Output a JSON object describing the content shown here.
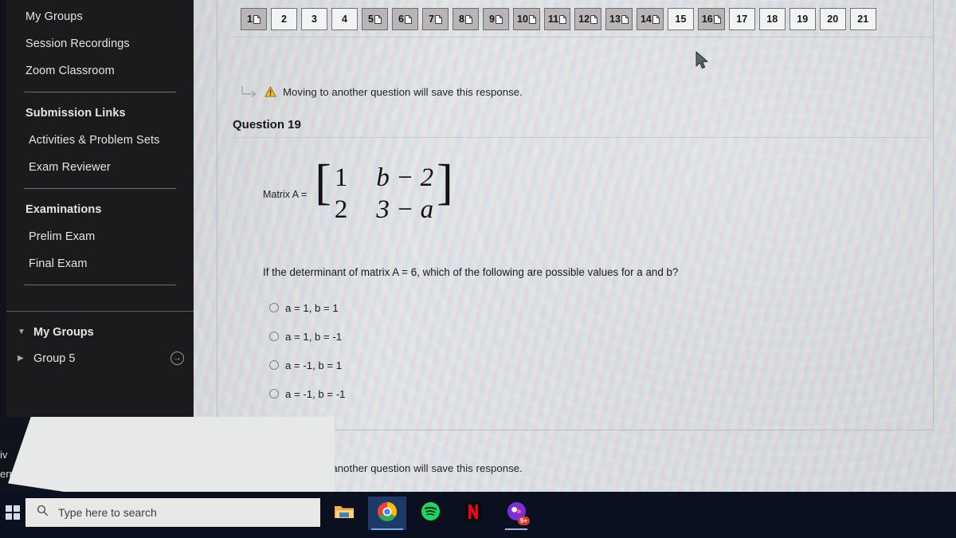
{
  "sidebar": {
    "top_items": [
      {
        "label": "My Groups",
        "bold": false
      },
      {
        "label": "Session Recordings",
        "bold": false
      },
      {
        "label": "Zoom Classroom",
        "bold": false
      }
    ],
    "section_submission": {
      "heading": "Submission Links",
      "items": [
        {
          "label": "Activities & Problem Sets"
        },
        {
          "label": "Exam Reviewer"
        }
      ]
    },
    "section_exams": {
      "heading": "Examinations",
      "items": [
        {
          "label": "Prelim Exam"
        },
        {
          "label": "Final Exam"
        }
      ]
    },
    "my_groups": {
      "heading": "My Groups",
      "expand_glyph": "▼",
      "items": [
        {
          "label": "Group 5",
          "collapse_glyph": "▶",
          "action_glyph": "→"
        }
      ]
    }
  },
  "occluded_window": {
    "fragment_top": "iv",
    "fragment_bottom": "err"
  },
  "question_nav": {
    "buttons": [
      {
        "number": "1",
        "has_doc_icon": true,
        "visited": true
      },
      {
        "number": "2",
        "has_doc_icon": false,
        "visited": false
      },
      {
        "number": "3",
        "has_doc_icon": false,
        "visited": false
      },
      {
        "number": "4",
        "has_doc_icon": false,
        "visited": false
      },
      {
        "number": "5",
        "has_doc_icon": true,
        "visited": true
      },
      {
        "number": "6",
        "has_doc_icon": true,
        "visited": true
      },
      {
        "number": "7",
        "has_doc_icon": true,
        "visited": true
      },
      {
        "number": "8",
        "has_doc_icon": true,
        "visited": true
      },
      {
        "number": "9",
        "has_doc_icon": true,
        "visited": true
      },
      {
        "number": "10",
        "has_doc_icon": true,
        "visited": true
      },
      {
        "number": "11",
        "has_doc_icon": true,
        "visited": true
      },
      {
        "number": "12",
        "has_doc_icon": true,
        "visited": true
      },
      {
        "number": "13",
        "has_doc_icon": true,
        "visited": true
      },
      {
        "number": "14",
        "has_doc_icon": true,
        "visited": true
      },
      {
        "number": "15",
        "has_doc_icon": false,
        "visited": false
      },
      {
        "number": "16",
        "has_doc_icon": true,
        "visited": true
      },
      {
        "number": "17",
        "has_doc_icon": false,
        "visited": false
      },
      {
        "number": "18",
        "has_doc_icon": false,
        "visited": false
      },
      {
        "number": "19",
        "has_doc_icon": false,
        "visited": false
      },
      {
        "number": "20",
        "has_doc_icon": false,
        "visited": false
      },
      {
        "number": "21",
        "has_doc_icon": false,
        "visited": false
      }
    ]
  },
  "notice_top": {
    "text": "Moving to another question will save this response."
  },
  "notice_bottom": {
    "text": "Moving to another question will save this response."
  },
  "question": {
    "heading": "Question 19",
    "matrix_label": "Matrix A =",
    "matrix": {
      "left_bracket": "[",
      "right_bracket": "]",
      "rows": [
        [
          {
            "text": "1",
            "italic": false
          },
          {
            "text": "b − 2",
            "italic": true
          }
        ],
        [
          {
            "text": "2",
            "italic": false
          },
          {
            "text": "3 − a",
            "italic": true
          }
        ]
      ]
    },
    "prompt": "If the determinant of matrix A = 6, which of the following are possible values for a and b?",
    "options": [
      {
        "label": "a = 1, b = 1",
        "selected": false
      },
      {
        "label": "a = 1, b = -1",
        "selected": false
      },
      {
        "label": "a = -1, b = 1",
        "selected": false
      },
      {
        "label": "a = -1, b = -1",
        "selected": false
      }
    ]
  },
  "taskbar": {
    "start_icon": "windows-logo-icon",
    "search": {
      "placeholder": "Type here to search",
      "icon": "search-icon"
    },
    "apps": [
      {
        "name": "file-explorer",
        "state": "idle",
        "badge": ""
      },
      {
        "name": "google-chrome",
        "state": "active",
        "badge": ""
      },
      {
        "name": "spotify",
        "state": "idle",
        "badge": ""
      },
      {
        "name": "netflix",
        "state": "idle",
        "badge": ""
      },
      {
        "name": "messaging-app",
        "state": "open",
        "badge": "9+"
      }
    ]
  },
  "colors": {
    "sidebar_bg": "#1b1b1d",
    "page_bg": "#e9eaec",
    "taskbar_bg": "#0b1020",
    "warning_yellow": "#e8b02a",
    "visited_button": "#b9b5b6",
    "chrome_highlight": "#1d3a66"
  }
}
